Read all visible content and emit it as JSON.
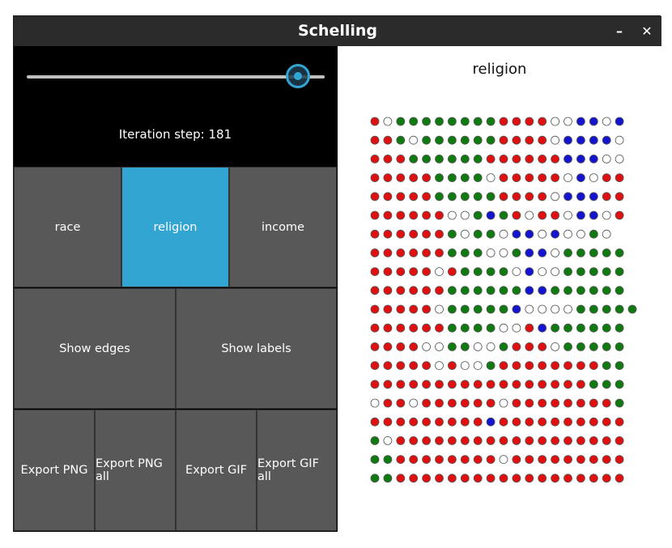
{
  "window": {
    "title": "Schelling",
    "minimize_glyph": "–",
    "close_glyph": "✕"
  },
  "controls": {
    "slider": {
      "value_fraction": 0.91
    },
    "iteration_label": "Iteration step:",
    "iteration_value": "181"
  },
  "mode_buttons": [
    {
      "label": "race",
      "active": false
    },
    {
      "label": "religion",
      "active": true
    },
    {
      "label": "income",
      "active": false
    }
  ],
  "toggle_buttons": [
    {
      "label": "Show edges"
    },
    {
      "label": "Show labels"
    }
  ],
  "export_buttons": [
    {
      "label": "Export PNG"
    },
    {
      "label": "Export PNG all"
    },
    {
      "label": "Export GIF"
    },
    {
      "label": "Export GIF all"
    }
  ],
  "grid_view": {
    "title": "religion",
    "colors": {
      "R": "#e01010",
      "G": "#0f7a0f",
      "B": "#1414d0",
      "W": "#ffffff",
      "outline": "#555555"
    },
    "rows": [
      "RWGGGGGGGGRRRRWWBBWB",
      "RRGWGGGGGGRRRRWBBBBW",
      "RRRGGGGGGRRRRRRBBBWW",
      "RRRRRGGGGWRRRRRWBWRR",
      "RRRRRGGGGGRRRRWBBBRR",
      "RRRRRRWWGBGRWRRWBBWR",
      "RRRRRRGWGGWBBWBWWGW",
      "RRRRRRGGGWWGBBWGGGGG",
      "RRRRRWRGGGGWBWWGGGGG",
      "RRRRRRGGGGGGBBGGGGGG",
      "RRRRRWGGGGGBWWWWGGGGG",
      "RRRRRRGGGGWWRBGGGGGG",
      "RRRRWWGGWWGRRRWGGGGG",
      "RRRRRWRWWGRRRRRRRRGG",
      "RRRRRRRRRRRRRRRRRGGG",
      "WRRWRRRRRRWRRRRRRRRG",
      "RRRRRRRRRBRRRRRRRRRR",
      "GWRRRRRRRRRRRRRRRRRR",
      "GGRRRRRRRRWRRRRRRRRR",
      "GGRRRRRRRRRRRRRRRRRR"
    ]
  }
}
